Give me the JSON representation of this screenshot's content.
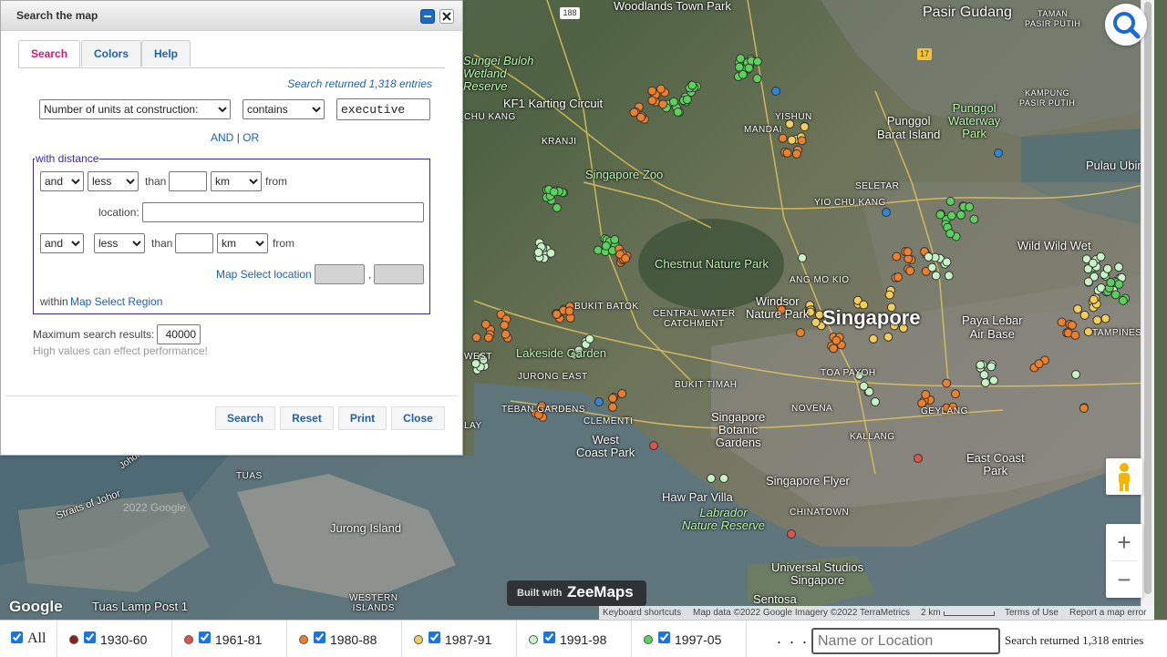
{
  "dialog": {
    "title": "Search the map",
    "tabs": [
      "Search",
      "Colors",
      "Help"
    ],
    "status": "Search returned 1,318 entries",
    "field_select": "Number of units at construction:",
    "op_select": "contains",
    "query_value": "executive",
    "and_label": "AND",
    "or_sep": "|",
    "or_label": "OR",
    "distance_legend": "with distance",
    "row1": {
      "conj": "and",
      "comp": "less",
      "than": "than",
      "unit": "km",
      "from": "from"
    },
    "location_label": "location:",
    "row2": {
      "conj": "and",
      "comp": "less",
      "than": "than",
      "unit": "km",
      "from": "from"
    },
    "map_select_location": "Map Select location",
    "comma": ",",
    "within": "within",
    "map_select_region": "Map Select Region",
    "max_label": "Maximum search results:",
    "max_value": "40000",
    "hint": "High values can effect performance!",
    "buttons": {
      "search": "Search",
      "reset": "Reset",
      "print": "Print",
      "close": "Close"
    }
  },
  "map": {
    "labels": {
      "woodlands_town_park": "Woodlands Town\nPark",
      "sungei_buloh": "Sungei Buloh\nWetland\nReserve",
      "kf1": "KF1 Karting Circuit",
      "chu_kang": "CHU KANG",
      "kranji": "KRANJI",
      "singapore_zoo": "Singapore Zoo",
      "yishun": "YISHUN",
      "mandai": "MANDAI",
      "punggol_barat": "Punggol\nBarat Island",
      "punggol_waterway": "Punggol\nWaterway\nPark",
      "pasir_gudang": "Pasir Gudang",
      "taman_pasir_putih": "TAMAN\nPASIR PUTIH",
      "kampung_pasir_putih": "KAMPUNG\nPASIR PUTIH",
      "seletar": "SELETAR",
      "yio_chu_kang": "YIO CHU KANG",
      "pulau_ubin": "Pulau Ubin",
      "wild_wild_wet": "Wild Wild Wet",
      "chestnut": "Chestnut Nature Park",
      "ang_mo_kio": "ANG MO KIO",
      "central_water": "CENTRAL WATER\nCATCHMENT",
      "windsor": "Windsor\nNature Park",
      "singapore": "Singapore",
      "paya_lebar": "Paya Lebar\nAir Base",
      "tampines": "TAMPINES",
      "bukit_batok": "BUKIT BATOK",
      "lakeside": "Lakeside Garden",
      "jurong_east": "JURONG EAST",
      "west": "WEST",
      "toa_payoh": "TOA PAYOH",
      "bukit_timah": "BUKIT TIMAH",
      "novena": "NOVENA",
      "geylang": "GEYLANG",
      "kallang": "KALLANG",
      "tebang": "TEBAN GARDENS",
      "clementi": "CLEMENTI",
      "west_coast_park": "West\nCoast Park",
      "botanic": "Singapore\nBotanic\nGardens",
      "east_coast": "East Coast\nPark",
      "lay": "LAY",
      "tuas": "TUAS",
      "straits": "Straits of Johor",
      "jurong_island": "Jurong Island",
      "haw_par": "Haw Par Villa",
      "labrador": "Labrador\nNature Reserve",
      "singapore_flyer": "Singapore Flyer",
      "chinatown": "CHINATOWN",
      "universal": "Universal Studios\nSingapore",
      "sentosa": "Sentosa",
      "western_islands": "WESTERN\nISLANDS",
      "tuas_lamp": "Tuas Lamp Post 1",
      "johor": "Johor",
      "road_188": "188",
      "road_17": "17",
      "google_faint": "2022 Google"
    },
    "google": "Google",
    "builtwith": "Built with",
    "zeemaps": "ZeeMaps",
    "attribution": {
      "shortcuts": "Keyboard shortcuts",
      "mapdata": "Map data ©2022 Google Imagery ©2022 TerraMetrics",
      "scale": "2 km",
      "terms": "Terms of Use",
      "report": "Report a map error"
    },
    "zoom_in": "+",
    "zoom_out": "−"
  },
  "legend": {
    "all": "All",
    "items": [
      {
        "label": "1930-60",
        "color": "#8b1f1f"
      },
      {
        "label": "1961-81",
        "color": "#e0524a"
      },
      {
        "label": "1980-88",
        "color": "#ef7f2a"
      },
      {
        "label": "1987-91",
        "color": "#f3cf5a"
      },
      {
        "label": "1991-98",
        "color": "#c8f5c6"
      },
      {
        "label": "1997-05",
        "color": "#59d25a"
      }
    ],
    "ellipsis": ". . .",
    "search_placeholder": "Name or Location",
    "status": "Search returned 1,318 entries"
  },
  "marker_colors": {
    "green": "#59d25a",
    "light_green": "#c8f5c6",
    "yellow": "#f3cf5a",
    "orange": "#ef7f2a",
    "red": "#e0524a",
    "blue": "#2f86d8"
  }
}
